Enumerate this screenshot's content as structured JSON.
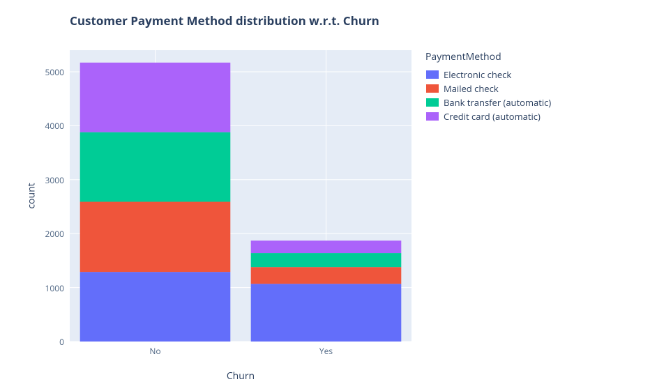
{
  "chart_data": {
    "type": "bar",
    "stacked": true,
    "title": "Customer Payment Method distribution w.r.t. Churn",
    "xlabel": "Churn",
    "ylabel": "count",
    "categories": [
      "No",
      "Yes"
    ],
    "series": [
      {
        "name": "Electronic check",
        "color": "#636efa",
        "values": [
          1290,
          1070
        ]
      },
      {
        "name": "Mailed check",
        "color": "#ef553b",
        "values": [
          1300,
          310
        ]
      },
      {
        "name": "Bank transfer (automatic)",
        "color": "#00cc96",
        "values": [
          1290,
          260
        ]
      },
      {
        "name": "Credit card (automatic)",
        "color": "#ab63fa",
        "values": [
          1290,
          230
        ]
      }
    ],
    "ylim": [
      0,
      5400
    ],
    "yticks": [
      0,
      1000,
      2000,
      3000,
      4000,
      5000
    ],
    "legend_title": "PaymentMethod",
    "grid": true
  }
}
